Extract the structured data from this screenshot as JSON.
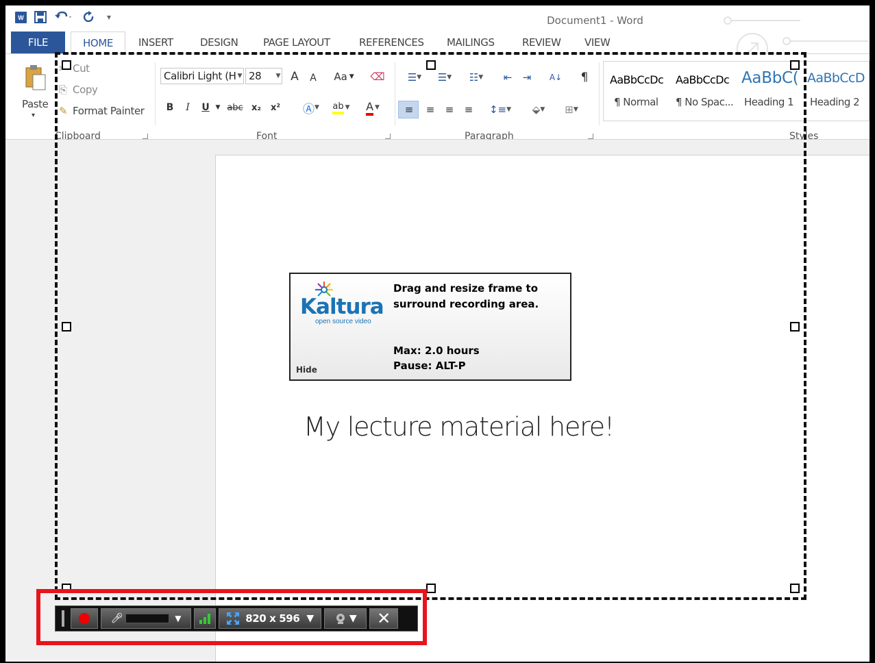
{
  "window": {
    "title": "Document1 - Word"
  },
  "qat": {
    "word_logo": "W",
    "save_icon": "save-icon",
    "undo_icon": "undo-icon",
    "redo_icon": "redo-icon",
    "more": "▾"
  },
  "tabs": [
    "FILE",
    "HOME",
    "INSERT",
    "DESIGN",
    "PAGE LAYOUT",
    "REFERENCES",
    "MAILINGS",
    "REVIEW",
    "VIEW"
  ],
  "clipboard": {
    "paste": "Paste",
    "cut": "Cut",
    "copy": "Copy",
    "format_painter": "Format Painter",
    "group_label": "Clipboard"
  },
  "font": {
    "font_name": "Calibri Light (H",
    "font_size": "28",
    "grow": "A",
    "shrink": "A",
    "case": "Aa",
    "bold": "B",
    "italic": "I",
    "underline": "U",
    "strike": "abc",
    "subscript": "x₂",
    "superscript": "x²",
    "group_label": "Font"
  },
  "paragraph": {
    "group_label": "Paragraph",
    "sort": "A↓",
    "pilcrow": "¶"
  },
  "styles": {
    "group_label": "Styles",
    "items": [
      {
        "preview": "AaBbCcDc",
        "name": "¶ Normal"
      },
      {
        "preview": "AaBbCcDc",
        "name": "¶ No Spac..."
      },
      {
        "preview": "AaBbC(",
        "name": "Heading 1"
      },
      {
        "preview": "AaBbCcD",
        "name": "Heading 2"
      }
    ]
  },
  "document": {
    "body_text": "My lecture material here!"
  },
  "kaltura": {
    "logo_text": "Kaltura",
    "tagline": "open source video",
    "instructions_line1": "Drag and resize frame to",
    "instructions_line2": "surround recording area.",
    "max": "Max: 2.0 hours",
    "pause": "Pause: ALT-P",
    "hide": "Hide"
  },
  "recorder": {
    "dimensions": "820 x 596",
    "drop": "▼",
    "close": "✕"
  },
  "colors": {
    "accent": "#2b579a",
    "record": "#e00000",
    "highlight_box": "#e8141c",
    "kaltura_blue": "#1c73b4"
  }
}
